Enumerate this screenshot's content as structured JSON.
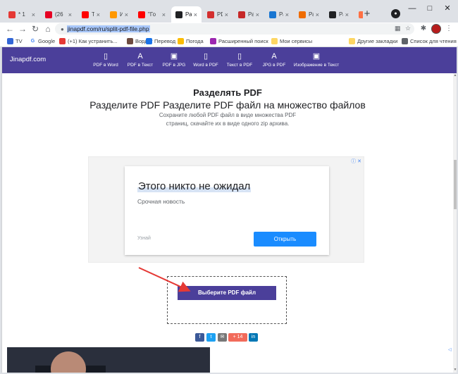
{
  "tabs": [
    {
      "title": "* 1",
      "color": "#e53935",
      "active": false
    },
    {
      "title": "(26",
      "color": "#e60023",
      "active": false
    },
    {
      "title": "Тай",
      "color": "#ff0000",
      "active": false
    },
    {
      "title": "Изб",
      "color": "#ff9800",
      "active": false
    },
    {
      "title": "\"Го",
      "color": "#ff0000",
      "active": false
    },
    {
      "title": "Раз",
      "color": "#202124",
      "active": true
    },
    {
      "title": "PDF",
      "color": "#d32f2f",
      "active": false
    },
    {
      "title": "Раз",
      "color": "#c62828",
      "active": false
    },
    {
      "title": "Раз",
      "color": "#1976d2",
      "active": false
    },
    {
      "title": "Раз",
      "color": "#ef6c00",
      "active": false
    },
    {
      "title": "Раз",
      "color": "#202124",
      "active": false
    },
    {
      "title": "Раз",
      "color": "#ff7043",
      "active": false
    }
  ],
  "tab_close": "×",
  "new_tab": "+",
  "window": {
    "minimize": "—",
    "maximize": "□",
    "close": "✕"
  },
  "toolbar": {
    "back": "←",
    "forward": "→",
    "reload": "↻",
    "home": "⌂",
    "url": "jinapdf.com/ru/split-pdf-file.php",
    "lock": "🔒",
    "qr": "▦",
    "star": "☆",
    "extensions": "✱",
    "menu": "⋮"
  },
  "bookmarks": [
    {
      "label": "TV",
      "color": "#3367d6"
    },
    {
      "label": "Google",
      "color": "#4285f4",
      "glyph": "G"
    },
    {
      "label": "(+1) Как устранить...",
      "color": "#e53935"
    },
    {
      "label": "Вордст",
      "color": "#6d4c41"
    },
    {
      "label": "Перевод",
      "color": "#1a73e8"
    },
    {
      "label": "Погода",
      "color": "#fbbc04"
    },
    {
      "label": "Расширенный поиск",
      "color": "#9c27b0"
    },
    {
      "label": "Мои сервисы",
      "color": "#fdd663"
    },
    {
      "label": "Другие закладки",
      "color": "#fdd663"
    },
    {
      "label": "Список для чтения",
      "color": "#5f6368"
    }
  ],
  "site": {
    "logo": "Jinapdf.com",
    "nav": [
      {
        "label": "PDF в Word",
        "icon": "file-icon",
        "glyph": "▯"
      },
      {
        "label": "PDF в Текст",
        "icon": "text-icon",
        "glyph": "A"
      },
      {
        "label": "PDF в JPG",
        "icon": "image-icon",
        "glyph": "▣"
      },
      {
        "label": "Word в PDF",
        "icon": "file-icon",
        "glyph": "▯"
      },
      {
        "label": "Текст в PDF",
        "icon": "file-icon",
        "glyph": "▯"
      },
      {
        "label": "JPG в PDF",
        "icon": "text-icon",
        "glyph": "A"
      },
      {
        "label": "Изображение в Текст",
        "icon": "image-icon",
        "glyph": "▣"
      }
    ],
    "title": "Разделять PDF",
    "subtitle": "Разделите PDF Разделите PDF файл на множество файлов",
    "description": "Сохраните любой PDF файл в виде множества PDF страниц, скачайте их в виде одного zip архива.",
    "ad": {
      "headline": "Этого никто не ожидал",
      "sub": "Срочная новость",
      "learn": "Узнай",
      "cta": "Открыть",
      "close": "ⓘ ✕"
    },
    "upload_button": "Выберите PDF файл",
    "share_buttons": [
      {
        "label": "f",
        "color": "#3b5998",
        "icon": "facebook-icon"
      },
      {
        "label": "t",
        "color": "#1da1f2",
        "icon": "twitter-icon"
      },
      {
        "label": "✉",
        "color": "#777777",
        "icon": "mail-icon"
      },
      {
        "label": "+ 14",
        "color": "#f26b5b",
        "icon": "plus-icon"
      },
      {
        "label": "in",
        "color": "#0077b5",
        "icon": "linkedin-icon"
      }
    ],
    "adchoices": "◁"
  },
  "colors": {
    "brand": "#4b3f9a",
    "accent": "#1a8cff",
    "arrow": "#e53935"
  }
}
